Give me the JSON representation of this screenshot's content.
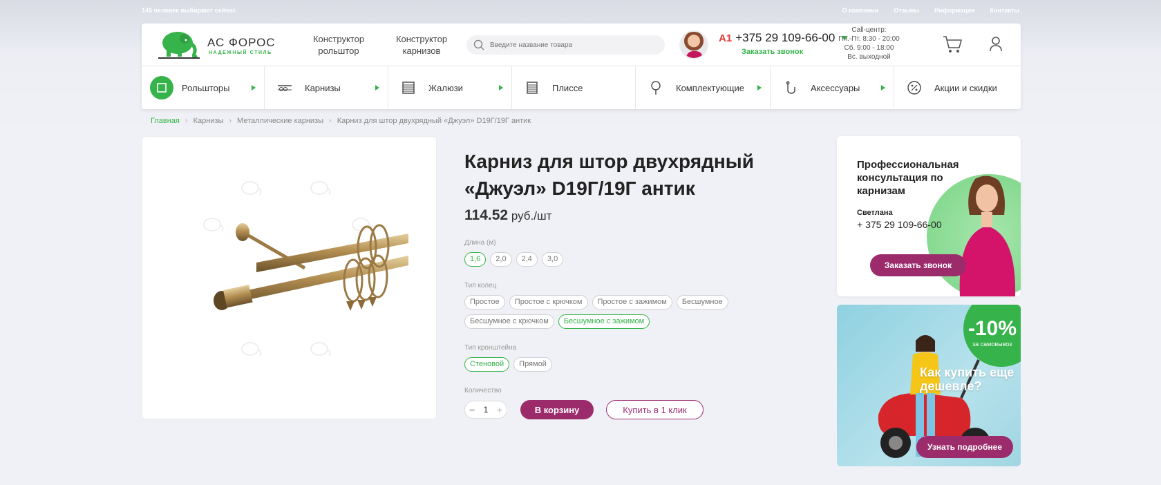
{
  "topbar": {
    "viewers": "145 человек выбирают сейчас",
    "links": [
      "О компании",
      "Отзывы",
      "Информация",
      "Контакты"
    ]
  },
  "header": {
    "logo_title": "АС ФОРОС",
    "logo_sub": "НАДЕЖНЫЙ СТИЛЬ",
    "link1": "Конструктор рольштор",
    "link2": "Конструктор карнизов",
    "search_placeholder": "Введите название товара",
    "phone_operator": "A1",
    "phone": "+375 29 109-66-00",
    "callback": "Заказать звонок",
    "callcenter": [
      "Call-центр:",
      "Пн.-Пт. 8:30 - 20:00",
      "Сб. 9:00 - 18:00",
      "Вс. выходной"
    ]
  },
  "nav": [
    {
      "label": "Рольшторы",
      "icon": "roller-blind-icon"
    },
    {
      "label": "Карнизы",
      "icon": "cornice-icon"
    },
    {
      "label": "Жалюзи",
      "icon": "blinds-icon"
    },
    {
      "label": "Плиссе",
      "icon": "pleated-icon"
    },
    {
      "label": "Комплектующие",
      "icon": "bulb-icon"
    },
    {
      "label": "Аксессуары",
      "icon": "hook-icon"
    },
    {
      "label": "Акции и скидки",
      "icon": "percent-icon"
    }
  ],
  "breadcrumbs": [
    "Главная",
    "Карнизы",
    "Металлические карнизы",
    "Карниз для штор двухрядный «Джуэл» D19Г/19Г антик"
  ],
  "product": {
    "title": "Карниз для штор двухрядный «Джуэл» D19Г/19Г антик",
    "price": "114.52",
    "unit": "руб./шт",
    "length_label": "Длина (м)",
    "lengths": [
      "1,6",
      "2,0",
      "2,4",
      "3,0"
    ],
    "length_selected": 0,
    "rings_label": "Тип колец",
    "rings": [
      "Простое",
      "Простое с крючком",
      "Простое с зажимом",
      "Бесшумное",
      "Бесшумное с крючком",
      "Бесшумное с зажимом"
    ],
    "rings_selected": 5,
    "bracket_label": "Тип кронштейна",
    "brackets": [
      "Стеновой",
      "Прямой"
    ],
    "bracket_selected": 0,
    "qty_label": "Количество",
    "qty": "1",
    "minus": "−",
    "plus": "+",
    "add_to_cart": "В корзину",
    "buy_one_click": "Купить в 1 клик"
  },
  "consult": {
    "title": "Профессиональная консультация по карнизам",
    "name": "Светлана",
    "phone": "+ 375 29 109-66-00",
    "button": "Заказать звонок"
  },
  "promo": {
    "discount": "-10%",
    "pickup": "за самовывоз",
    "question": "Как купить еще дешевле?",
    "button": "Узнать подробнее"
  },
  "colors": {
    "green": "#36b34a",
    "purple": "#9c2b6c"
  }
}
